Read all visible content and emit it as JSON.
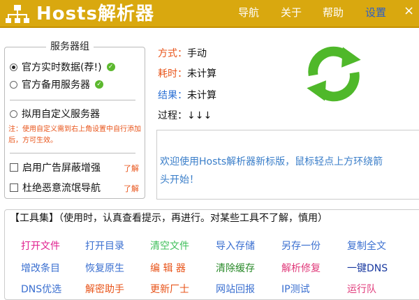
{
  "app": {
    "title": "Hosts解析器",
    "nav": {
      "home": "导航",
      "about": "关于",
      "help": "帮助",
      "settings": "设置",
      "close": "×"
    }
  },
  "server_group": {
    "title": "服务器组",
    "official_realtime": "官方实时数据(荐!)",
    "official_backup": "官方备用服务器",
    "custom_server": "拟用自定义服务器",
    "note": "注：使用自定义需到右上角设置中自行添加后，方可生效。",
    "ad_block": "启用广告屏蔽增强",
    "anti_hijack": "杜绝恶意流氓导航",
    "learn_more": "了解"
  },
  "status": {
    "method_label": "方式：",
    "method_value": "手动",
    "time_label": "耗时：",
    "time_value": "未计算",
    "result_label": "结果：",
    "result_value": "未计算",
    "process_label": "过程：",
    "process_value": "↓↓↓"
  },
  "message": {
    "line1": "欢迎使用Hosts解析器新标版，鼠标轻点上方环绕箭",
    "line2": "头开始！"
  },
  "tools": {
    "title": "【工具集】（使用时，认真查看提示，再进行。对某些工具不了解，慎用）",
    "row1": [
      "打开文件",
      "打开目录",
      "清空文件",
      "导入存储",
      "另存一份",
      "复制全文"
    ],
    "row2": [
      "增改条目",
      "恢复原生",
      "编 辑 器",
      "清除缓存",
      "解析修复",
      "一键DNS"
    ],
    "row3": [
      "DNS优选",
      "解密助手",
      "更新厂士",
      "网站回报",
      "IP测试",
      "运行队"
    ]
  },
  "colors": {
    "titlebar": "#d9a80f",
    "accent_orange": "#e8541a",
    "accent_blue": "#2a6fd4",
    "refresh_green": "#4fb82a"
  }
}
